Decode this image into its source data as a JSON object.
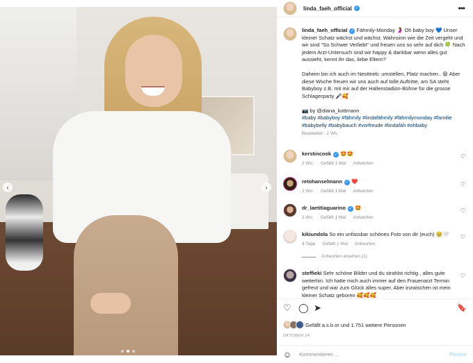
{
  "post": {
    "author": "linda_faeh_official",
    "caption_paragraphs": [
      "Fähmily-Monday 🤰 Oh baby boy 💙 Unser kleiner Schatz wächst und wächst. Wahnsinn wie die Zeit vergeht und wir sind \"So Schwer Verliebt\" und freuen uns so sehr auf dich 🍀 Nach jedem Arzt-Untersuch sind wir happy & dankbar wenn alles gut aussieht, kennt ihr das, liebe Eltern?",
      "Daheim bin ich auch im Nesttrieb: umstellen, Platz machen.. 😄 Aber diese Woche freuen wir uns auch auf tolle Auftritte, am SA steht Babyboy z.B. mit mir auf der Hallenstadion-Bühne für die grosse Schlagerparty 🎤🥰"
    ],
    "photo_credit": "📷 by @diana_kottmann",
    "hashtags": "#baby #babyboy #fähmily #lindafähmily #fähmilymonday #familie #babybelly #babybauch #vorfreude #lindafäh #ohbaby",
    "caption_meta": "Bearbeitet · 2 Wo.",
    "likes_text": "Gefällt a.s.b.or und 1.751 weitere Personen",
    "date": "OKTOBER 24",
    "comment_placeholder": "Kommentieren ...",
    "post_label": "Posten"
  },
  "comments": [
    {
      "user": "kerstincook",
      "verified": true,
      "text": "🤩🤩",
      "time": "2 Wo.",
      "likes": "Gefällt 1 Mal",
      "reply": "Antworten",
      "heart": "♡"
    },
    {
      "user": "retohanselmann",
      "verified": true,
      "text": "❤️",
      "time": "2 Wo.",
      "likes": "Gefällt 1 Mal",
      "reply": "Antworten",
      "heart": "♡"
    },
    {
      "user": "dr_laetitiaguarino",
      "verified": true,
      "text": "🤩",
      "time": "2 Wo.",
      "likes": "Gefällt 1 Mal",
      "reply": "Antworten",
      "heart": "♡"
    },
    {
      "user": "kikiundola",
      "verified": false,
      "text": "So ein unfassbar schönes Foto von dir (euch) 🥹🤍",
      "time": "4 Tage",
      "likes": "Gefällt 1 Mal",
      "reply": "Antworten",
      "heart": "♡",
      "view_replies": "Antworten ansehen (1)"
    },
    {
      "user": "steffieki",
      "verified": false,
      "text": "Sehr schöne Bilder und du strahlst richtig , alles gute weiterhin. Ich hatte mich auch immer auf den Frauenarzt Termin gefreut und war zum Glück alles super. Aber inzwischen ist mein kleiner Schatz geboren 🥰🥰🥰",
      "time": "",
      "likes": "",
      "reply": "",
      "heart": "♡"
    }
  ],
  "icons": {
    "more": "•••",
    "heart": "♡",
    "comment": "◯",
    "share": "➤",
    "bookmark": "🔖",
    "emoji": "☺",
    "prev": "‹",
    "next": "›"
  },
  "carousel": {
    "current_slide": 2,
    "total_slides": 3
  }
}
